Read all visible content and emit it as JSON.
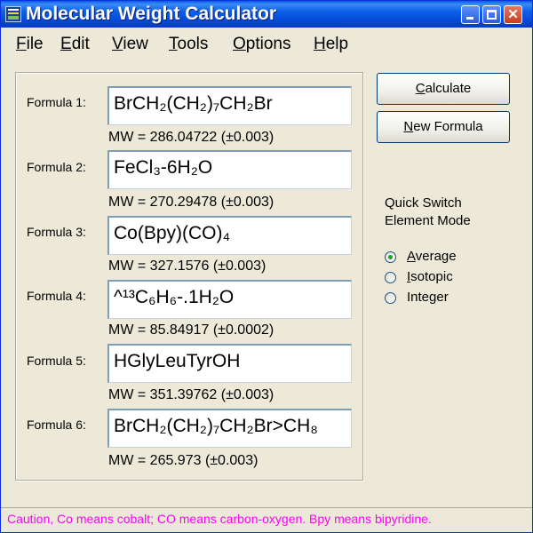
{
  "window": {
    "title": "Molecular Weight Calculator"
  },
  "menu": {
    "items": [
      {
        "first": "F",
        "rest": "ile"
      },
      {
        "first": "E",
        "rest": "dit"
      },
      {
        "first": "V",
        "rest": "iew"
      },
      {
        "first": "T",
        "rest": "ools"
      },
      {
        "first": "O",
        "rest": "ptions"
      },
      {
        "first": "H",
        "rest": "elp"
      }
    ]
  },
  "formulas": [
    {
      "label": "Formula 1:",
      "value": "BrCH₂(CH₂)₇CH₂Br",
      "mw": "MW = 286.04722 (±0.003)"
    },
    {
      "label": "Formula 2:",
      "value": "FeCl₃-6H₂O",
      "mw": "MW = 270.29478 (±0.003)"
    },
    {
      "label": "Formula 3:",
      "value": "Co(Bpy)(CO)₄",
      "mw": "MW = 327.1576 (±0.003)"
    },
    {
      "label": "Formula 4:",
      "value": "^¹³C₆H₆-.1H₂O",
      "mw": "MW = 85.84917 (±0.0002)"
    },
    {
      "label": "Formula 5:",
      "value": "HGlyLeuTyrOH",
      "mw": "MW = 351.39762 (±0.003)"
    },
    {
      "label": "Formula 6:",
      "value": "BrCH₂(CH₂)₇CH₂Br>CH₈",
      "mw": "MW = 265.973 (±0.003)"
    }
  ],
  "buttons": {
    "calculate": {
      "first": "C",
      "rest": "alculate"
    },
    "new_formula": {
      "first": "N",
      "rest": "ew Formula"
    }
  },
  "quick_switch": {
    "heading_line1": "Quick Switch",
    "heading_line2": "Element Mode",
    "options": [
      {
        "first": "A",
        "rest": "verage",
        "selected": true
      },
      {
        "first": "I",
        "rest": "sotopic",
        "selected": false
      },
      {
        "first": "I",
        "rest": "nteger",
        "selected": false
      }
    ]
  },
  "status": {
    "text": "Caution, Co means cobalt; CO means carbon-oxygen.  Bpy means bipyridine.",
    "color": "#ff00ff"
  }
}
